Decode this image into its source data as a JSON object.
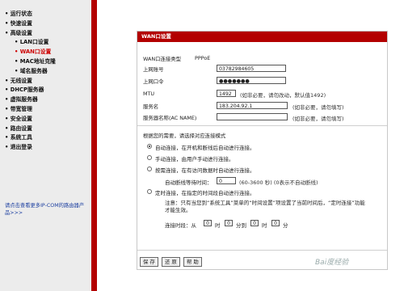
{
  "sidebar": {
    "items": [
      {
        "label": "• 运行状态",
        "sub": false
      },
      {
        "label": "• 快速设置",
        "sub": false
      },
      {
        "label": "• 高级设置",
        "sub": false
      },
      {
        "label": "• LAN口设置",
        "sub": true
      },
      {
        "label": "• WAN口设置",
        "sub": true,
        "active": true
      },
      {
        "label": "• MAC地址克隆",
        "sub": true
      },
      {
        "label": "• 域名服务器",
        "sub": true
      },
      {
        "label": "• 无线设置",
        "sub": false
      },
      {
        "label": "• DHCP服务器",
        "sub": false
      },
      {
        "label": "• 虚拟服务器",
        "sub": false
      },
      {
        "label": "• 带宽管理",
        "sub": false
      },
      {
        "label": "• 安全设置",
        "sub": false
      },
      {
        "label": "• 路由设置",
        "sub": false
      },
      {
        "label": "• 系统工具",
        "sub": false
      },
      {
        "label": "• 退出登录",
        "sub": false
      }
    ],
    "note": "请点击查看更多IP-COM的路由器产品>>>"
  },
  "panel": {
    "title": "WAN口设置",
    "conn_type_label": "WAN口连接类型",
    "conn_type_value": "PPPoE",
    "account_label": "上网账号",
    "account_value": "03782984605",
    "password_label": "上网口令",
    "password_value": "●●●●●●●",
    "mtu_label": "MTU",
    "mtu_value": "1492",
    "mtu_hint": "(如非必要，请勿改动，默认值1492)",
    "service_label": "服务名",
    "service_value": "183.204.92.1",
    "service_hint": "(如非必要，请勿填写)",
    "acname_label": "服务器名称(AC NAME)",
    "acname_value": "",
    "acname_hint": "(如非必要，请勿填写)",
    "mode_title": "根据您的需要，请选择对应连接模式",
    "mode_auto": "自动连接，在开机和断线后自动进行连接。",
    "mode_manual": "手动连接，由用户手动进行连接。",
    "mode_demand": "按需连接，在有访问数据时自动进行连接。",
    "idle_label": "自动断线等待时间：",
    "idle_value": "0",
    "idle_hint": "(60-3600 秒)  (0表示不自动断线)",
    "mode_timed": "定时连接，在指定的时间段自动进行连接。",
    "note_text": "注意：只有当您到“系统工具”菜单的“时间设置”项设置了当前时间后，“定时连接”功能才能生效。",
    "period_label": "连接时段：从",
    "from_h": "0",
    "hour": "时",
    "from_m": "0",
    "minute_to": "分到",
    "to_h": "0",
    "to_m": "0",
    "minute": "分",
    "btn_save": "保 存",
    "btn_restore": "还 原",
    "btn_help": "帮 助"
  },
  "watermark": "Bai度经验"
}
